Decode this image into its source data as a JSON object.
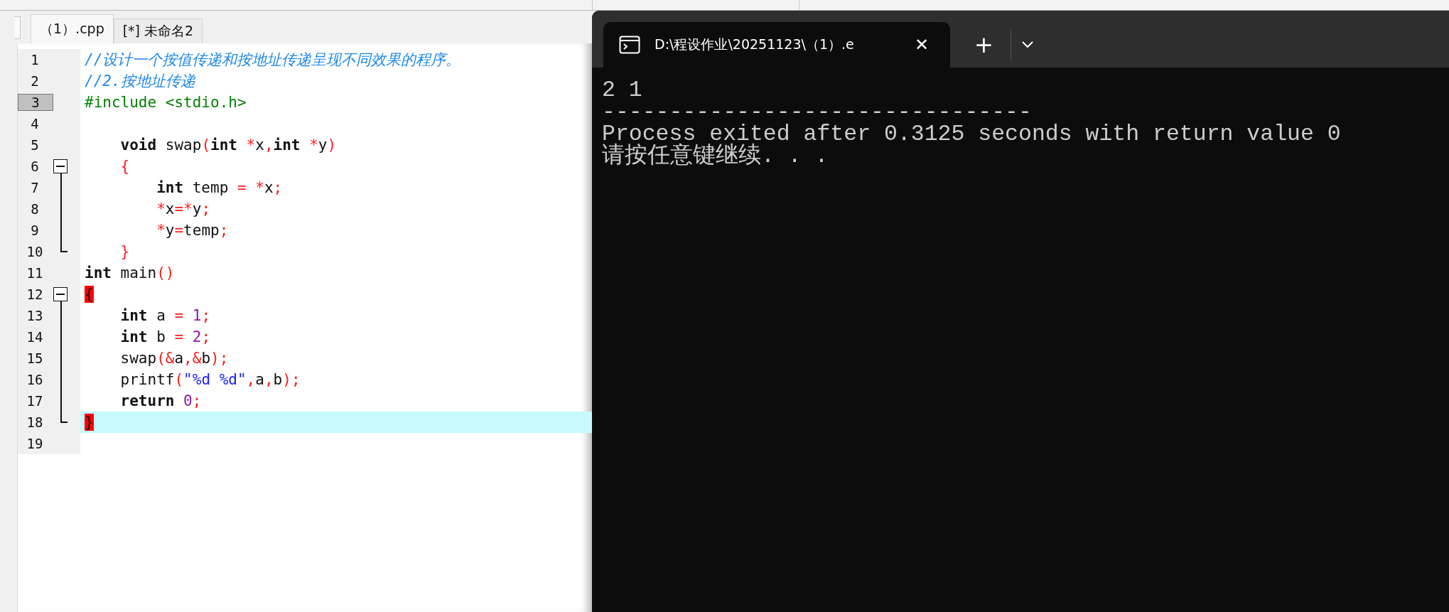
{
  "editor": {
    "tabs": [
      {
        "label": "（1）.cpp",
        "selected": true
      },
      {
        "label": "[*] 未命名2",
        "selected": false
      }
    ],
    "lines": [
      {
        "number": "1",
        "kind": "plain",
        "marked": false,
        "current": false,
        "tokens": [
          {
            "kind": "comment",
            "text": "//设计一个按值传递和按地址传递呈现不同效果的程序。"
          }
        ]
      },
      {
        "number": "2",
        "kind": "plain",
        "marked": false,
        "current": false,
        "tokens": [
          {
            "kind": "comment",
            "text": "//2.按地址传递"
          }
        ]
      },
      {
        "number": "3",
        "kind": "plain",
        "marked": true,
        "current": false,
        "tokens": [
          {
            "kind": "preprocessor",
            "text": "#include <stdio.h>"
          }
        ]
      },
      {
        "number": "4",
        "kind": "plain",
        "marked": false,
        "current": false
      },
      {
        "number": "5",
        "kind": "plain",
        "marked": false,
        "current": false,
        "tokens": [
          {
            "kind": "keyword",
            "text": "    void"
          },
          {
            "kind": "plain",
            "text": " swap"
          },
          {
            "kind": "operator",
            "text": "("
          },
          {
            "kind": "keyword",
            "text": "int"
          },
          {
            "kind": "operator",
            "text": " *"
          },
          {
            "kind": "plain",
            "text": "x"
          },
          {
            "kind": "operator",
            "text": ","
          },
          {
            "kind": "keyword",
            "text": "int"
          },
          {
            "kind": "operator",
            "text": " *"
          },
          {
            "kind": "plain",
            "text": "y"
          },
          {
            "kind": "operator",
            "text": ")"
          }
        ]
      },
      {
        "number": "6",
        "kind": "foldstart",
        "marked": false,
        "current": false,
        "tokens": [
          {
            "kind": "operator",
            "text": "    {"
          }
        ]
      },
      {
        "number": "7",
        "kind": "folded",
        "marked": false,
        "current": false,
        "tokens": [
          {
            "kind": "keyword",
            "text": "        int"
          },
          {
            "kind": "plain",
            "text": " temp"
          },
          {
            "kind": "operator",
            "text": " = *"
          },
          {
            "kind": "plain",
            "text": "x"
          },
          {
            "kind": "operator",
            "text": ";"
          }
        ]
      },
      {
        "number": "8",
        "kind": "folded",
        "marked": false,
        "current": false,
        "tokens": [
          {
            "kind": "operator",
            "text": "        *"
          },
          {
            "kind": "plain",
            "text": "x"
          },
          {
            "kind": "operator",
            "text": "=*"
          },
          {
            "kind": "plain",
            "text": "y"
          },
          {
            "kind": "operator",
            "text": ";"
          }
        ]
      },
      {
        "number": "9",
        "kind": "folded",
        "marked": false,
        "current": false,
        "tokens": [
          {
            "kind": "operator",
            "text": "        *"
          },
          {
            "kind": "plain",
            "text": "y"
          },
          {
            "kind": "operator",
            "text": "="
          },
          {
            "kind": "plain",
            "text": "temp"
          },
          {
            "kind": "operator",
            "text": ";"
          }
        ]
      },
      {
        "number": "10",
        "kind": "foldend",
        "marked": false,
        "current": false,
        "tokens": [
          {
            "kind": "operator",
            "text": "    }"
          }
        ]
      },
      {
        "number": "11",
        "kind": "plain",
        "marked": false,
        "current": false,
        "tokens": [
          {
            "kind": "keyword",
            "text": "int"
          },
          {
            "kind": "plain",
            "text": " main"
          },
          {
            "kind": "operator",
            "text": "()"
          }
        ]
      },
      {
        "number": "12",
        "kind": "foldstart",
        "marked": false,
        "current": false,
        "tokens": [
          {
            "kind": "brace-match",
            "text": "{"
          }
        ]
      },
      {
        "number": "13",
        "kind": "folded",
        "marked": false,
        "current": false,
        "tokens": [
          {
            "kind": "keyword",
            "text": "    int"
          },
          {
            "kind": "plain",
            "text": " a"
          },
          {
            "kind": "operator",
            "text": " ="
          },
          {
            "kind": "number",
            "text": " 1"
          },
          {
            "kind": "operator",
            "text": ";"
          }
        ]
      },
      {
        "number": "14",
        "kind": "folded",
        "marked": false,
        "current": false,
        "tokens": [
          {
            "kind": "keyword",
            "text": "    int"
          },
          {
            "kind": "plain",
            "text": " b"
          },
          {
            "kind": "operator",
            "text": " ="
          },
          {
            "kind": "number",
            "text": " 2"
          },
          {
            "kind": "operator",
            "text": ";"
          }
        ]
      },
      {
        "number": "15",
        "kind": "folded",
        "marked": false,
        "current": false,
        "tokens": [
          {
            "kind": "plain",
            "text": "    swap"
          },
          {
            "kind": "operator",
            "text": "(&"
          },
          {
            "kind": "plain",
            "text": "a"
          },
          {
            "kind": "operator",
            "text": ",&"
          },
          {
            "kind": "plain",
            "text": "b"
          },
          {
            "kind": "operator",
            "text": ");"
          }
        ]
      },
      {
        "number": "16",
        "kind": "folded",
        "marked": false,
        "current": false,
        "tokens": [
          {
            "kind": "plain",
            "text": "    printf"
          },
          {
            "kind": "operator",
            "text": "("
          },
          {
            "kind": "string",
            "text": "\"%d %d\""
          },
          {
            "kind": "operator",
            "text": ","
          },
          {
            "kind": "plain",
            "text": "a"
          },
          {
            "kind": "operator",
            "text": ","
          },
          {
            "kind": "plain",
            "text": "b"
          },
          {
            "kind": "operator",
            "text": ");"
          }
        ]
      },
      {
        "number": "17",
        "kind": "folded",
        "marked": false,
        "current": false,
        "tokens": [
          {
            "kind": "keyword",
            "text": "    return"
          },
          {
            "kind": "number",
            "text": " 0"
          },
          {
            "kind": "operator",
            "text": ";"
          }
        ]
      },
      {
        "number": "18",
        "kind": "foldend",
        "marked": false,
        "current": true,
        "tokens": [
          {
            "kind": "brace-match",
            "text": "}"
          }
        ]
      },
      {
        "number": "19",
        "kind": "plain",
        "marked": false,
        "current": false
      }
    ]
  },
  "terminal": {
    "tab_title": "D:\\程设作业\\20251123\\（1）.e",
    "close": "✕",
    "new_tab": "+",
    "output": [
      "2 1",
      "--------------------------------",
      "Process exited after 0.3125 seconds with return value 0",
      "请按任意键继续. . ."
    ]
  }
}
